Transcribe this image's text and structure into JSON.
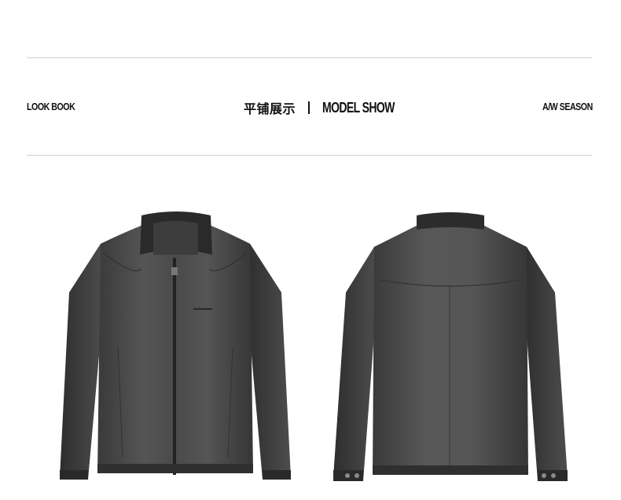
{
  "header": {
    "left_label": "LOOK BOOK",
    "title_cn": "平铺展示",
    "title_en": "MODEL SHOW",
    "right_label": "A/W SEASON"
  },
  "products": [
    {
      "view": "front",
      "item": "black leather jacket"
    },
    {
      "view": "back",
      "item": "black leather jacket"
    }
  ]
}
